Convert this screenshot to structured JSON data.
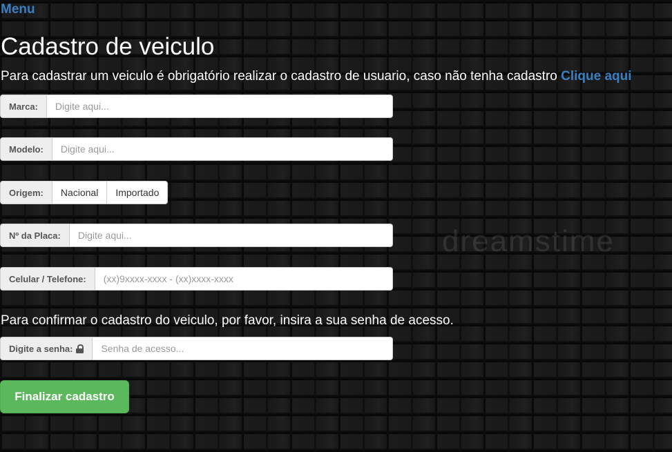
{
  "nav": {
    "menu_label": "Menu"
  },
  "page": {
    "title": "Cadastro de veiculo",
    "intro_text": "Para cadastrar um veiculo é obrigatório realizar o cadastro de usuario, caso não tenha cadastro ",
    "intro_link": "Clique aqui"
  },
  "form": {
    "marca": {
      "label": "Marca:",
      "placeholder": "Digite aqui..."
    },
    "modelo": {
      "label": "Modelo:",
      "placeholder": "Digite aqui..."
    },
    "origem": {
      "label": "Origem:",
      "options": [
        "Nacional",
        "Importado"
      ]
    },
    "placa": {
      "label": "Nº da Placa:",
      "placeholder": "Digite aqui..."
    },
    "telefone": {
      "label": "Celular / Telefone:",
      "placeholder": "(xx)9xxxx-xxxx - (xx)xxxx-xxxx"
    },
    "confirm_text": "Para confirmar o cadastro do veiculo, por favor, insira a sua senha de acesso.",
    "senha": {
      "label": "Digite a senha:",
      "placeholder": "Senha de acesso...",
      "icon": "lock-icon"
    },
    "submit_label": "Finalizar cadastro"
  },
  "background": {
    "watermark": "dreamstime"
  },
  "colors": {
    "link": "#3a7fc2",
    "submit": "#5cb85c",
    "addon_bg": "#eeeeee"
  }
}
